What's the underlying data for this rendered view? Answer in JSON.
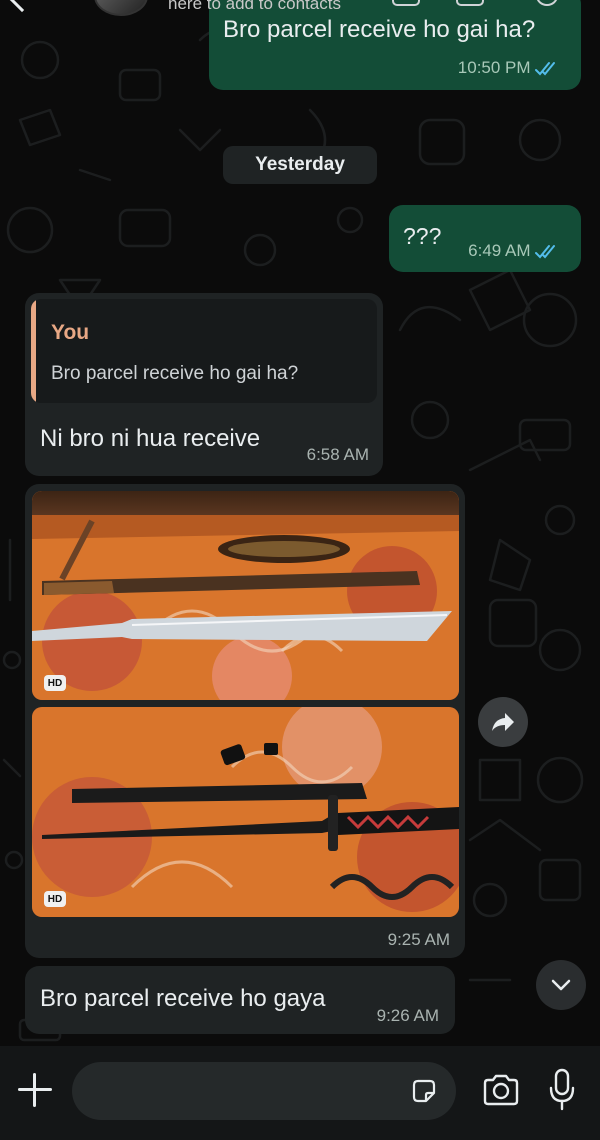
{
  "header": {
    "subtitle": "here to add to contacts"
  },
  "messages": [
    {
      "text": "Bro parcel receive ho gai ha?",
      "time": "10:50 PM",
      "direction": "outgoing",
      "status": "read"
    },
    {
      "text": "???",
      "time": "6:49 AM",
      "direction": "outgoing",
      "status": "read"
    },
    {
      "quote_author": "You",
      "quote_text": "Bro parcel receive ho gai ha?",
      "text": "Ni bro ni hua receive",
      "time": "6:58 AM",
      "direction": "incoming"
    },
    {
      "type": "photos",
      "badges": [
        "HD",
        "HD"
      ],
      "time": "9:25 AM",
      "direction": "incoming"
    },
    {
      "text": "Bro parcel receive ho gaya",
      "time": "9:26 AM",
      "direction": "incoming"
    }
  ],
  "date_separator": "Yesterday",
  "colors": {
    "outgoing_bubble": "#134d37",
    "incoming_bubble": "#1f2324",
    "quote_accent": "#e8a885",
    "read_ticks": "#53bdeb",
    "background": "#0b0b0b"
  },
  "icons": {
    "back": "chevron-left-icon",
    "forward": "forward-arrow-icon",
    "scroll_down": "chevron-down-icon",
    "attach": "plus-icon",
    "sticker": "sticker-icon",
    "camera": "camera-icon",
    "mic": "microphone-icon",
    "read": "double-check-icon"
  }
}
